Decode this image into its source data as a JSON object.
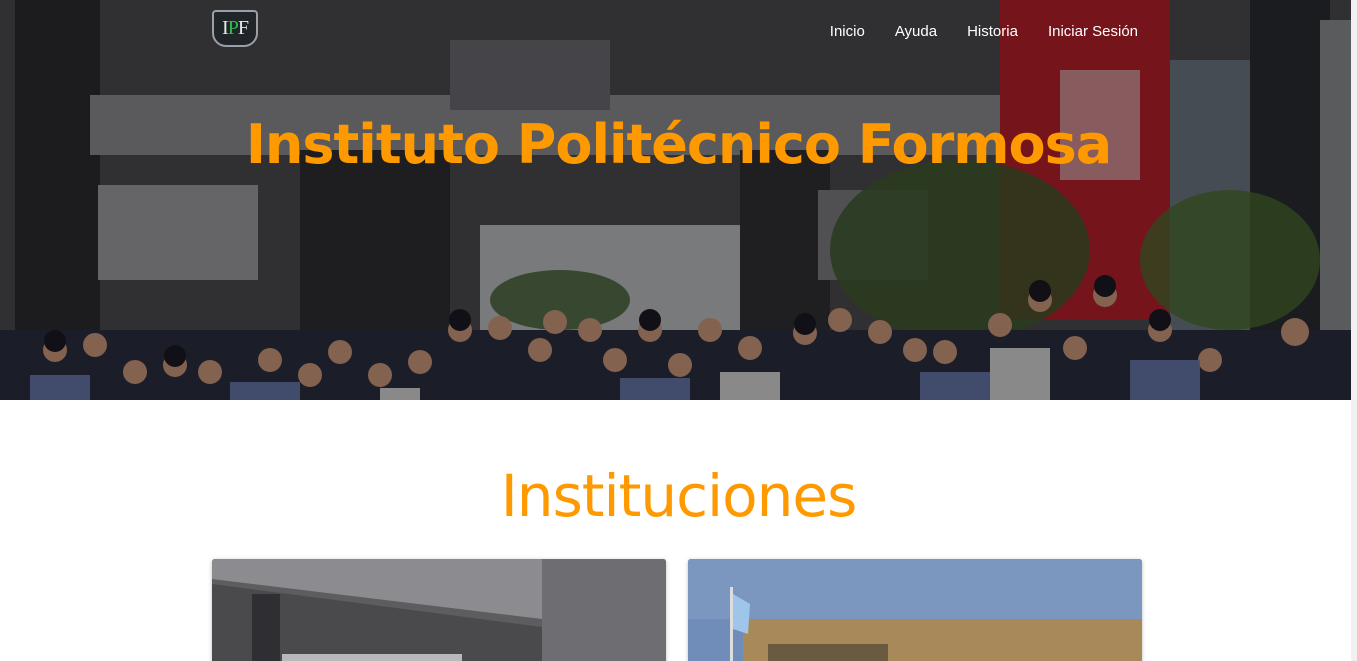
{
  "brand": {
    "logo_left": "I",
    "logo_mid": "P",
    "logo_right": "F"
  },
  "nav": {
    "items": [
      {
        "label": "Inicio"
      },
      {
        "label": "Ayuda"
      },
      {
        "label": "Historia"
      },
      {
        "label": "Iniciar Sesión"
      }
    ]
  },
  "hero": {
    "title": "Instituto Politécnico Formosa"
  },
  "sections": {
    "instituciones_title": "Instituciones"
  },
  "colors": {
    "accent": "#ff9900",
    "nav_text": "#ffffff",
    "logo_green": "#2fbf4a"
  }
}
